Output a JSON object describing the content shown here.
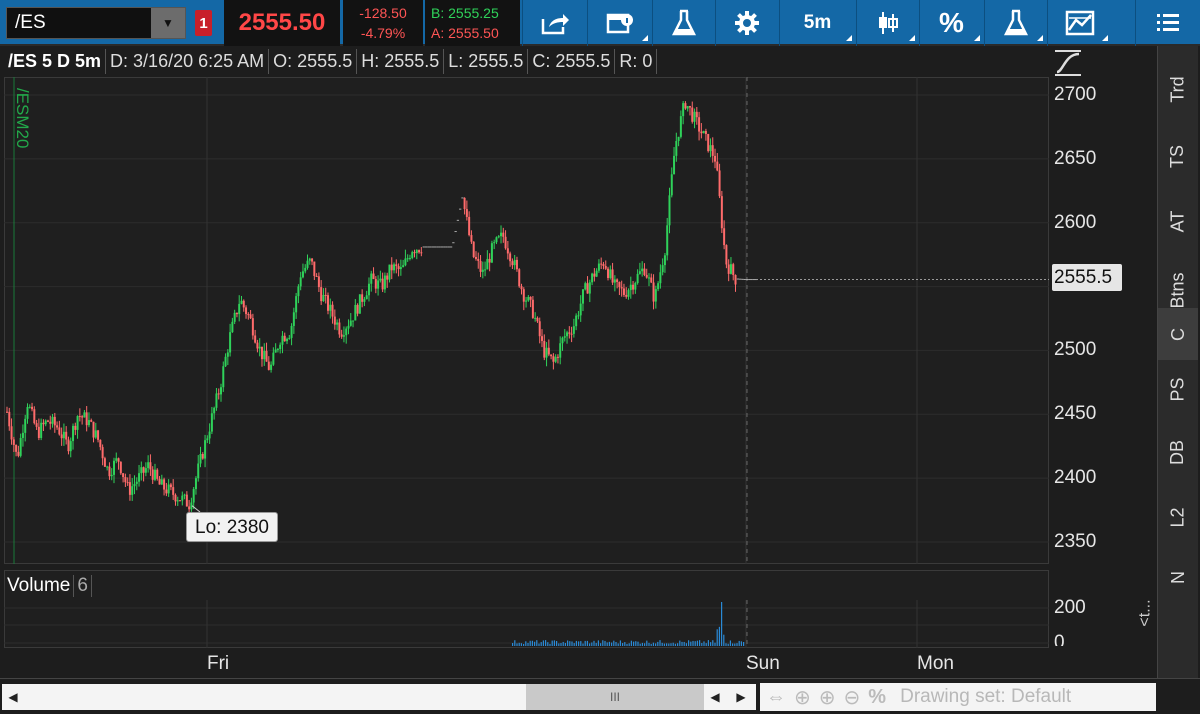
{
  "toolbar": {
    "symbol": "/ES",
    "badge": "1",
    "last_price": "2555.50",
    "net_change": "-128.50",
    "pct_change": "-4.79%",
    "bid": "B: 2555.25",
    "ask": "A: 2555.50",
    "timeframe": "5m",
    "percent_label": "%",
    "icons": [
      "share-icon",
      "info-icon",
      "flask-icon",
      "gear-icon",
      "timeframe-button",
      "candle-style-icon",
      "percent-icon",
      "flask-icon",
      "drawing-icon",
      "menu-icon"
    ]
  },
  "infobar": {
    "title": "/ES 5 D 5m",
    "date": "D: 3/16/20 6:25 AM",
    "open": "O: 2555.5",
    "high": "H: 2555.5",
    "low": "L: 2555.5",
    "close": "C: 2555.5",
    "range": "R: 0"
  },
  "chart": {
    "contract_label": "/ESM20",
    "price_ticks": [
      "2700",
      "2650",
      "2600",
      "2500",
      "2450",
      "2400",
      "2350"
    ],
    "current_price_tag": "2555.5",
    "low_tag": "Lo: 2380",
    "up_color": "#2fd25a",
    "down_color": "#ff6b6b"
  },
  "volume": {
    "label": "Volume",
    "value": "6",
    "ticks": [
      "200",
      "0"
    ]
  },
  "time_axis": [
    "Fri",
    "Sun",
    "Mon"
  ],
  "side_tabs": [
    "Trd",
    "TS",
    "AT",
    "Btns",
    "C",
    "PS",
    "DB",
    "L2",
    "N"
  ],
  "side_collapse": "<t...",
  "bottom": {
    "drawing_set": "Drawing set: Default",
    "scroll_grip": "III"
  },
  "chart_data": {
    "type": "candlestick",
    "ylim": [
      2330,
      2705
    ],
    "yticks": [
      2350,
      2400,
      2450,
      2500,
      2550,
      2600,
      2650,
      2700
    ],
    "close_path": [
      2452,
      2415,
      2460,
      2435,
      2445,
      2440,
      2425,
      2450,
      2445,
      2430,
      2405,
      2415,
      2390,
      2400,
      2410,
      2395,
      2390,
      2385,
      2380,
      2410,
      2440,
      2470,
      2510,
      2540,
      2525,
      2500,
      2485,
      2510,
      2515,
      2560,
      2570,
      2545,
      2530,
      2515,
      2525,
      2540,
      2555,
      2550,
      2565,
      2562,
      2580,
      2581,
      2581,
      2581,
      2581,
      2620,
      2575,
      2560,
      2580,
      2590,
      2570,
      2545,
      2530,
      2500,
      2490,
      2510,
      2520,
      2545,
      2560,
      2570,
      2550,
      2545,
      2555,
      2565,
      2540,
      2580,
      2660,
      2695,
      2680,
      2665,
      2650,
      2570,
      2556,
      2555.5,
      2555.5
    ]
  }
}
